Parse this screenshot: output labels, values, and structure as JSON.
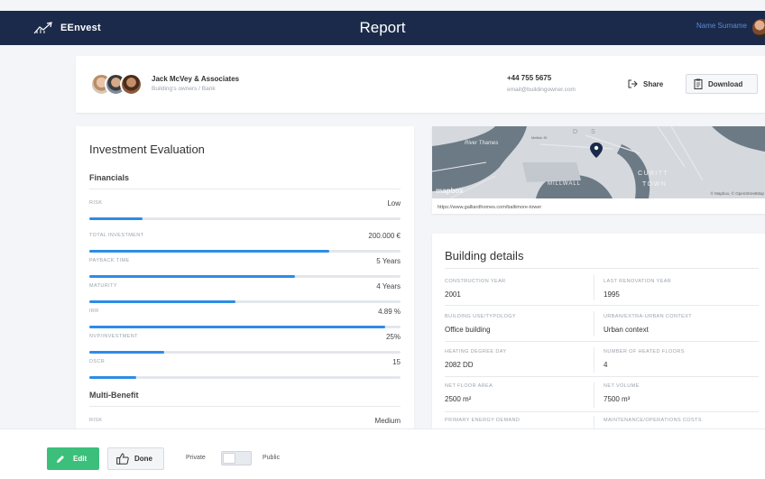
{
  "header": {
    "app_name": "EEnvest",
    "page_title": "Report",
    "user_name": "Name Surname"
  },
  "owner": {
    "name": "Jack McVey & Associates",
    "role": "Building's owners / Bank",
    "phone": "+44 755 5675",
    "email": "email@buildingowner.com",
    "share_label": "Share",
    "download_label": "Download"
  },
  "investment": {
    "title": "Investment Evaluation",
    "financials_heading": "Financials",
    "financials": [
      {
        "label": "RISK",
        "value": "Low",
        "progress": 0.17
      },
      {
        "label": "TOTAL INVESTMENT",
        "value": "200.000 €",
        "progress": 0.77
      },
      {
        "label": "PAYBACK TIME",
        "value": "5 Years",
        "progress": 0.66
      },
      {
        "label": "MATURITY",
        "value": "4 Years",
        "progress": 0.47
      },
      {
        "label": "IRR",
        "value": "4.89 %",
        "progress": 0.95
      },
      {
        "label": "NVP/INVESTMENT",
        "value": "25%",
        "progress": 0.24
      },
      {
        "label": "DSCR",
        "value": "15",
        "progress": 0.15
      }
    ],
    "multibenefit_heading": "Multi-Benefit",
    "multibenefit": [
      {
        "label": "RISK",
        "value": "Medium"
      }
    ]
  },
  "map": {
    "url": "https://www.galliardhomes.com/baltimore-tower",
    "labels": [
      "River Thames",
      "Mellish St",
      "D",
      "S",
      "MILLWALL",
      "CUBITT",
      "TOWN"
    ],
    "attribution": "© Mapbox, © OpenStreetMap",
    "logo": "mapbox"
  },
  "building": {
    "title": "Building details",
    "fields": [
      {
        "label": "CONSTRUCTION YEAR",
        "value": "2001"
      },
      {
        "label": "LAST RENOVATION YEAR",
        "value": "1995"
      },
      {
        "label": "BUILDING USE/TYPOLOGY",
        "value": "Office building"
      },
      {
        "label": "URBAN/EXTRA-URBAN CONTEXT",
        "value": "Urban context"
      },
      {
        "label": "HEATING DEGREE DAY",
        "value": "2082 DD"
      },
      {
        "label": "NUMBER OF HEATED FLOORS",
        "value": "4"
      },
      {
        "label": "NET FLOOR AREA",
        "value": "2500 m²"
      },
      {
        "label": "NET VOLUME",
        "value": "7500 m³"
      },
      {
        "label": "PRIMARY ENERGY DEMAND",
        "value": ""
      },
      {
        "label": "MAINTENANCE/OPERATIONS COSTS",
        "value": ""
      }
    ]
  },
  "footer": {
    "edit_label": "Edit",
    "done_label": "Done",
    "private_label": "Private",
    "public_label": "Public",
    "visibility": "Private"
  },
  "colors": {
    "header_bg": "#1b2a4a",
    "progress": "#2d8ce6",
    "edit_green": "#3bbf7b",
    "user_link": "#5d8bd6"
  }
}
